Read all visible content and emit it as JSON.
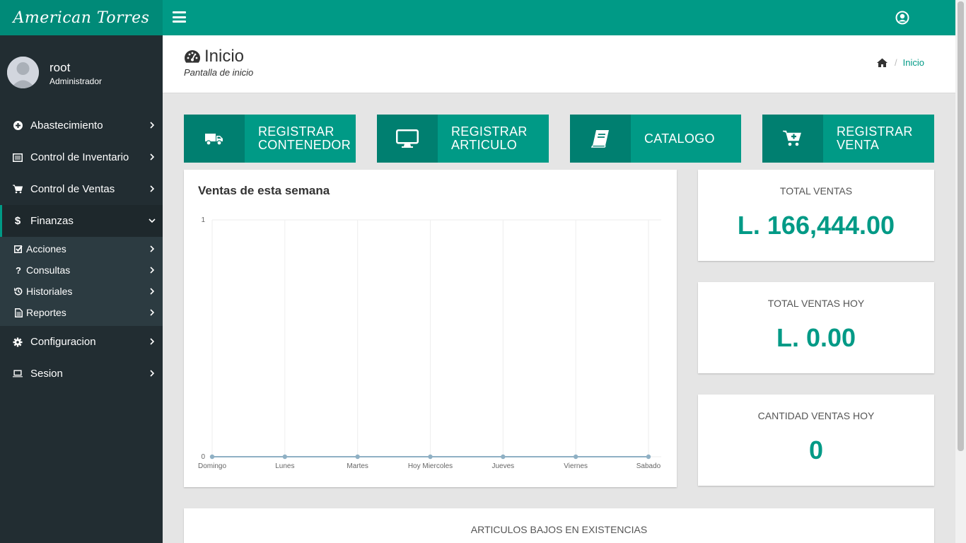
{
  "app": {
    "brand": "American Torres"
  },
  "user": {
    "name": "root",
    "role": "Administrador"
  },
  "sidebar": {
    "items": [
      {
        "label": "Abastecimiento",
        "icon": "plus-circle-icon"
      },
      {
        "label": "Control de Inventario",
        "icon": "list-alt-icon"
      },
      {
        "label": "Control de Ventas",
        "icon": "shopping-cart-icon"
      },
      {
        "label": "Finanzas",
        "icon": "dollar-icon",
        "expanded": true
      }
    ],
    "finanzas_sub": [
      {
        "label": "Acciones",
        "icon": "check-square-icon"
      },
      {
        "label": "Consultas",
        "icon": "question-icon"
      },
      {
        "label": "Historiales",
        "icon": "history-icon"
      },
      {
        "label": "Reportes",
        "icon": "file-text-icon"
      }
    ],
    "items_after": [
      {
        "label": "Configuracion",
        "icon": "gear-icon"
      },
      {
        "label": "Sesion",
        "icon": "laptop-icon"
      }
    ]
  },
  "header": {
    "title": "Inicio",
    "subtitle": "Pantalla de inicio",
    "breadcrumb": [
      "Inicio"
    ]
  },
  "actions": [
    {
      "label_line1": "REGISTRAR",
      "label_line2": "CONTENEDOR",
      "icon": "truck-icon"
    },
    {
      "label_line1": "REGISTRAR",
      "label_line2": "ARTICULO",
      "icon": "desktop-icon"
    },
    {
      "label_line1": "CATALOGO",
      "label_line2": "",
      "icon": "book-icon"
    },
    {
      "label_line1": "REGISTRAR",
      "label_line2": "VENTA",
      "icon": "cart-plus-icon"
    }
  ],
  "stats": [
    {
      "label": "TOTAL VENTAS",
      "value": "L. 166,444.00"
    },
    {
      "label": "TOTAL VENTAS HOY",
      "value": "L. 0.00"
    },
    {
      "label": "CANTIDAD VENTAS HOY",
      "value": "0"
    }
  ],
  "low_stock": {
    "title": "ARTICULOS BAJOS EN EXISTENCIAS"
  },
  "colors": {
    "accent": "#009a86",
    "accent_dark": "#007f70",
    "sidebar": "#222d32",
    "line": "#8fb0c4"
  },
  "chart_data": {
    "type": "line",
    "title": "Ventas de esta semana",
    "categories": [
      "Domingo",
      "Lunes",
      "Martes",
      "Hoy Miercoles",
      "Jueves",
      "Viernes",
      "Sabado"
    ],
    "values": [
      0,
      0,
      0,
      0,
      0,
      0,
      0
    ],
    "ylim": [
      0,
      1
    ],
    "yticks": [
      "1",
      "0"
    ],
    "grid": true
  }
}
